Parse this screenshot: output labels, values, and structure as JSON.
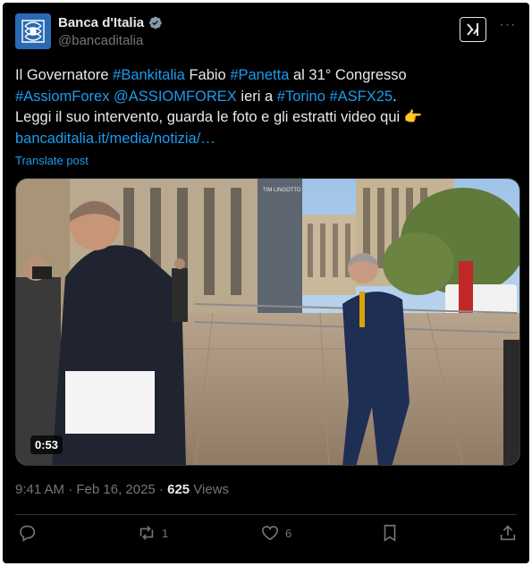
{
  "author": {
    "display_name": "Banca d'Italia",
    "handle": "@bancaditalia"
  },
  "post": {
    "line1": {
      "t1": "Il Governatore ",
      "l1": "#Bankitalia",
      "t2": " Fabio ",
      "l2": "#Panetta",
      "t3": " al 31° Congresso"
    },
    "line2": {
      "l1": "#AssiomForex",
      "t1": " ",
      "l2": "@ASSIOMFOREX",
      "t2": " ieri a ",
      "l3": "#Torino",
      "t3": " ",
      "l4": "#ASFX25",
      "t4": "."
    },
    "line3": "Leggi il suo intervento, guarda le foto e gli estratti video qui 👉",
    "link": "bancaditalia.it/media/notizia/…",
    "translate_label": "Translate post"
  },
  "video": {
    "duration": "0:53",
    "building_sign": "TIM LINGOTTO"
  },
  "meta": {
    "timestamp": "9:41 AM · Feb 16, 2025 · ",
    "views_count": "625",
    "views_label": " Views"
  },
  "actions": {
    "reposts": "1",
    "likes": "6"
  },
  "colors": {
    "background": "#000000",
    "text": "#e7e9ea",
    "muted": "#71767b",
    "link": "#1d9bf0",
    "verified": "#829aab"
  },
  "icons": [
    "verified-badge-icon",
    "grok-icon",
    "more-icon",
    "reply-icon",
    "repost-icon",
    "like-icon",
    "bookmark-icon",
    "share-icon"
  ]
}
